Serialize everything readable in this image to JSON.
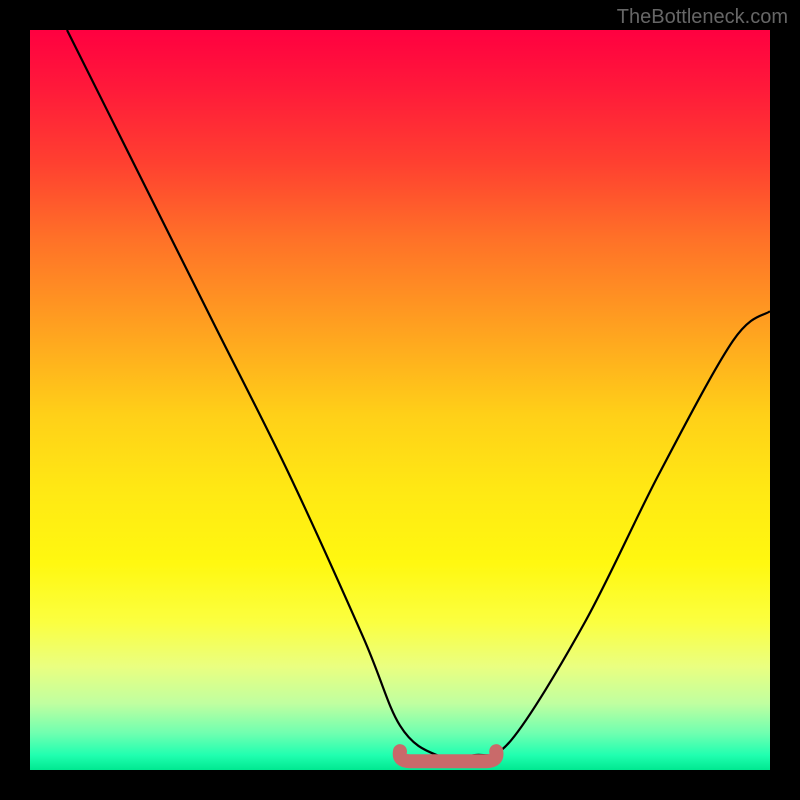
{
  "attribution": "TheBottleneck.com",
  "chart_data": {
    "type": "line",
    "title": "",
    "xlabel": "",
    "ylabel": "",
    "xlim": [
      0,
      100
    ],
    "ylim": [
      0,
      100
    ],
    "series": [
      {
        "name": "bottleneck-curve",
        "x": [
          5,
          15,
          25,
          35,
          45,
          50,
          55,
          60,
          65,
          75,
          85,
          95,
          100
        ],
        "y": [
          100,
          80,
          60,
          40,
          18,
          6,
          2,
          2,
          4,
          20,
          40,
          58,
          62
        ]
      }
    ],
    "marker": {
      "name": "optimal-range",
      "x_start": 50,
      "x_end": 63,
      "y": 2
    },
    "gradient_stops": [
      {
        "pos": 0,
        "color": "#ff0040"
      },
      {
        "pos": 50,
        "color": "#ffd018"
      },
      {
        "pos": 80,
        "color": "#fbff40"
      },
      {
        "pos": 100,
        "color": "#00e890"
      }
    ]
  }
}
